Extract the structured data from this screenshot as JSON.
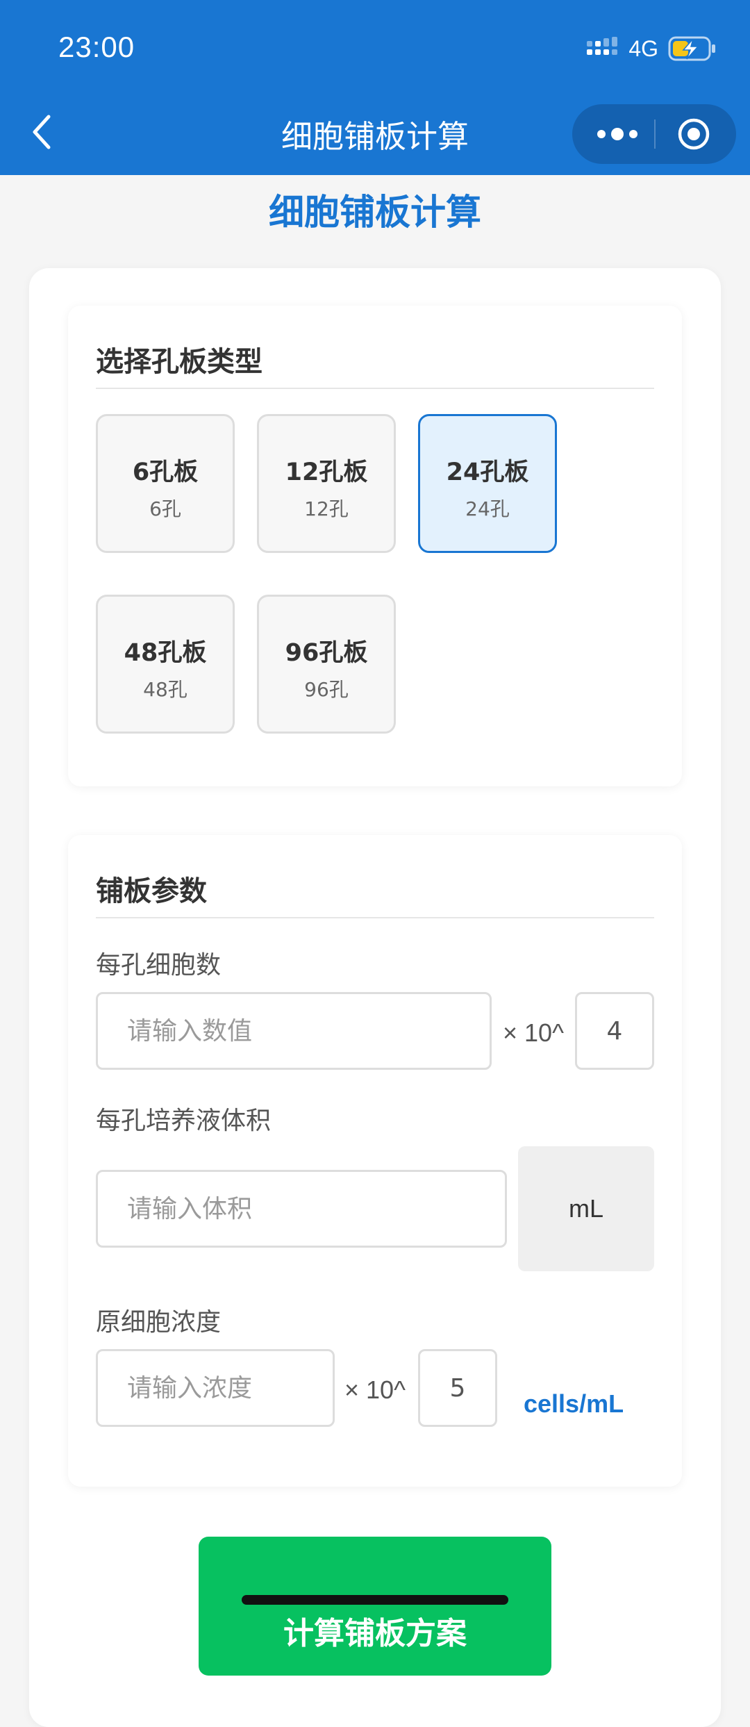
{
  "status_bar": {
    "time": "23:00",
    "network": "4G"
  },
  "nav": {
    "title": "细胞铺板计算"
  },
  "page": {
    "heading": "细胞铺板计算"
  },
  "plate_section": {
    "title": "选择孔板类型",
    "selected": "24孔板",
    "plates": [
      {
        "name": "6孔板",
        "count": "6孔"
      },
      {
        "name": "12孔板",
        "count": "12孔"
      },
      {
        "name": "24孔板",
        "count": "24孔"
      },
      {
        "name": "48孔板",
        "count": "48孔"
      },
      {
        "name": "96孔板",
        "count": "96孔"
      }
    ]
  },
  "params_section": {
    "title": "铺板参数",
    "cells_per_well": {
      "label": "每孔细胞数",
      "placeholder": "请输入数值",
      "multiplier": "× 10^",
      "exponent": "4"
    },
    "medium_volume": {
      "label": "每孔培养液体积",
      "placeholder": "请输入体积",
      "unit": "mL"
    },
    "stock_concentration": {
      "label": "原细胞浓度",
      "placeholder": "请输入浓度",
      "multiplier": "× 10^",
      "exponent": "5",
      "unit": "cells/mL"
    }
  },
  "actions": {
    "calculate_label": "计算铺板方案"
  },
  "colors": {
    "primary": "#1976d2",
    "selected_bg": "#e3f1fd",
    "button_green": "#07c160"
  }
}
